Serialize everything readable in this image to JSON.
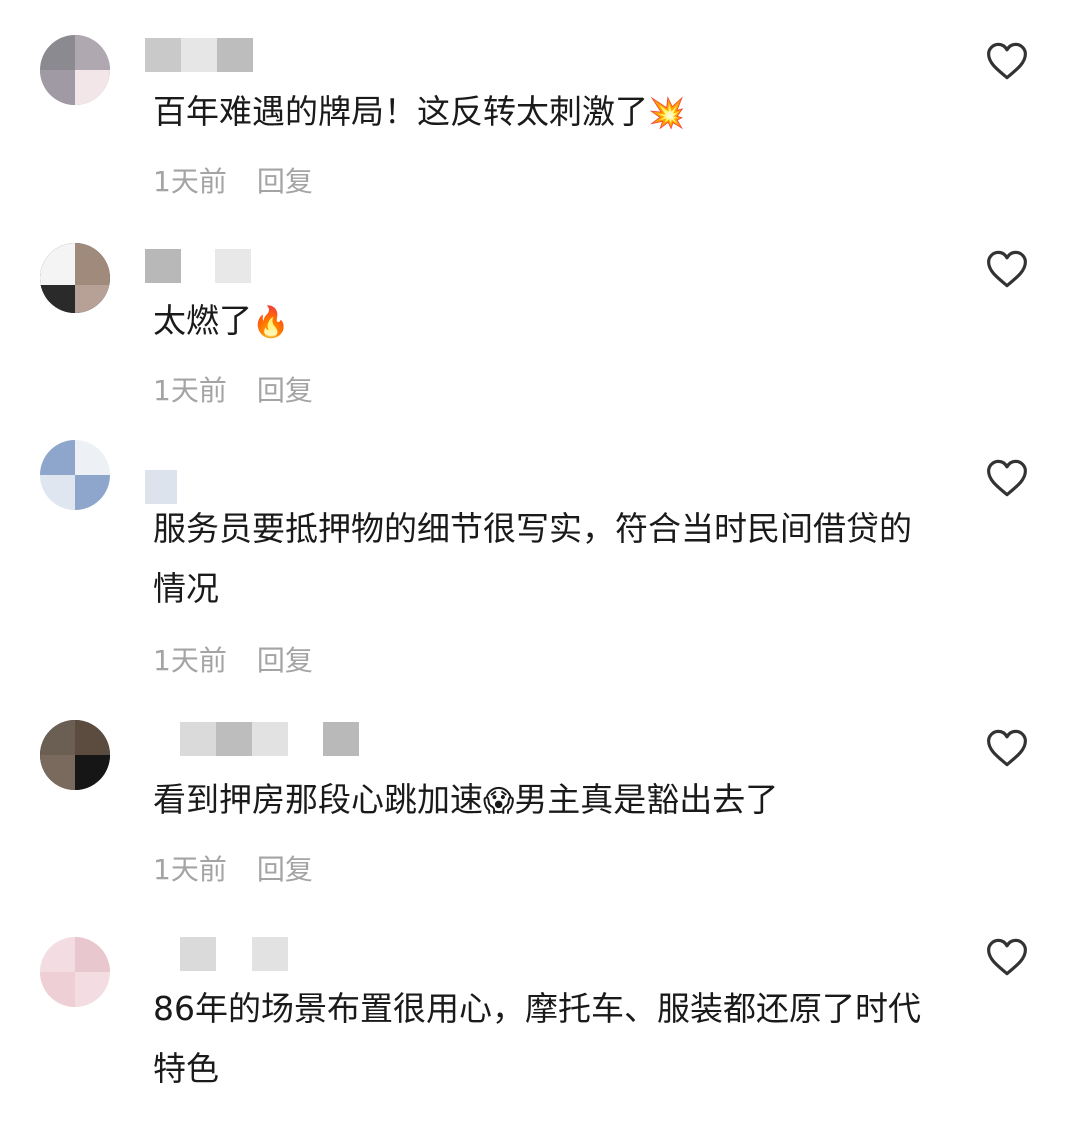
{
  "comments": [
    {
      "text": "百年难遇的牌局！这反转太刺激了",
      "emoji": "💥",
      "time": "1天前",
      "reply": "回复"
    },
    {
      "text": "太燃了",
      "emoji": "🔥",
      "time": "1天前",
      "reply": "回复"
    },
    {
      "text": "服务员要抵押物的细节很写实，符合当时民间借贷的情况",
      "emoji": "",
      "time": "1天前",
      "reply": "回复"
    },
    {
      "text": "看到押房那段心跳加速",
      "emoji": "😱",
      "text_after": "男主真是豁出去了",
      "time": "1天前",
      "reply": "回复"
    },
    {
      "text": "86年的场景布置很用心，摩托车、服装都还原了时代特色",
      "emoji": "",
      "time": "",
      "reply": ""
    }
  ],
  "icons": {
    "like": "heart-outline-icon"
  },
  "colors": {
    "text": "#1a1a1a",
    "meta": "#a4a4a4",
    "icon": "#333333"
  }
}
